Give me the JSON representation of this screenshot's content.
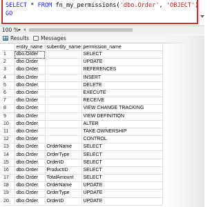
{
  "editor": {
    "line1": {
      "kw1": "SELECT",
      "op": " * ",
      "kw2": "FROM",
      "fn": " fn_my_permissions(",
      "arg1": "'dbo.Order'",
      "sep": ", ",
      "arg2": "'OBJECT'",
      "close": ")"
    },
    "line2": "GO"
  },
  "zoom_label": "100 %",
  "tabs": {
    "results": "Results",
    "messages": "Messages"
  },
  "grid": {
    "headers": [
      "entity_name",
      "subentity_name",
      "permission_name"
    ],
    "rows": [
      {
        "n": "1",
        "entity": "dbo.Order",
        "sub": "",
        "perm": "SELECT"
      },
      {
        "n": "2",
        "entity": "dbo.Order",
        "sub": "",
        "perm": "UPDATE"
      },
      {
        "n": "3",
        "entity": "dbo.Order",
        "sub": "",
        "perm": "REFERENCES"
      },
      {
        "n": "4",
        "entity": "dbo.Order",
        "sub": "",
        "perm": "INSERT"
      },
      {
        "n": "5",
        "entity": "dbo.Order",
        "sub": "",
        "perm": "DELETE"
      },
      {
        "n": "6",
        "entity": "dbo.Order",
        "sub": "",
        "perm": "EXECUTE"
      },
      {
        "n": "7",
        "entity": "dbo.Order",
        "sub": "",
        "perm": "RECEIVE"
      },
      {
        "n": "8",
        "entity": "dbo.Order",
        "sub": "",
        "perm": "VIEW CHANGE TRACKING"
      },
      {
        "n": "9",
        "entity": "dbo.Order",
        "sub": "",
        "perm": "VIEW DEFINITION"
      },
      {
        "n": "10",
        "entity": "dbo.Order",
        "sub": "",
        "perm": "ALTER"
      },
      {
        "n": "11",
        "entity": "dbo.Order",
        "sub": "",
        "perm": "TAKE OWNERSHIP"
      },
      {
        "n": "12",
        "entity": "dbo.Order",
        "sub": "",
        "perm": "CONTROL"
      },
      {
        "n": "13",
        "entity": "dbo.Order",
        "sub": "OrderName",
        "perm": "SELECT"
      },
      {
        "n": "14",
        "entity": "dbo.Order",
        "sub": "OrderType",
        "perm": "SELECT"
      },
      {
        "n": "15",
        "entity": "dbo.Order",
        "sub": "OrderID",
        "perm": "SELECT"
      },
      {
        "n": "16",
        "entity": "dbo.Order",
        "sub": "ProductID",
        "perm": "SELECT"
      },
      {
        "n": "17",
        "entity": "dbo.Order",
        "sub": "TotalAmount",
        "perm": "SELECT"
      },
      {
        "n": "18",
        "entity": "dbo.Order",
        "sub": "OrderName",
        "perm": "UPDATE"
      },
      {
        "n": "19",
        "entity": "dbo.Order",
        "sub": "OrderType",
        "perm": "UPDATE"
      },
      {
        "n": "20",
        "entity": "dbo.Order",
        "sub": "OrderID",
        "perm": "UPDATE"
      }
    ]
  },
  "colors": {
    "highlight_frame": "#d52b2b",
    "keyword": "#1a1aff",
    "string": "#c41a16"
  },
  "icons": {
    "results_tab": "grid-icon",
    "messages_tab": "message-icon"
  }
}
